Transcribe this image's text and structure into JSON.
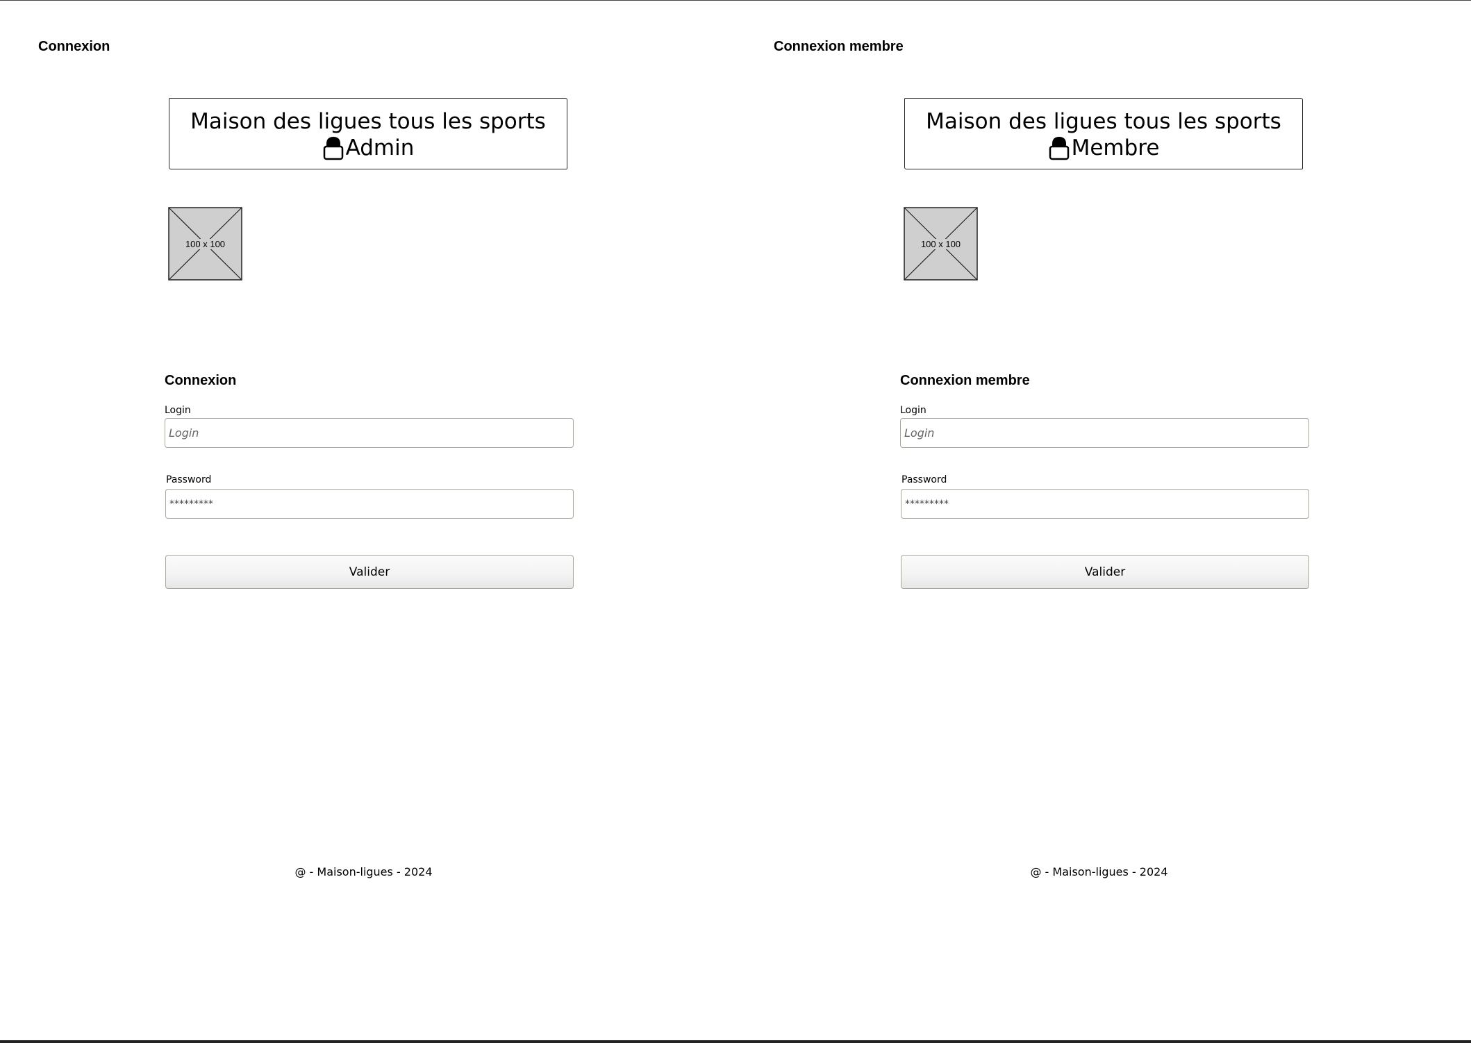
{
  "panels": [
    {
      "heading": "Connexion",
      "banner": {
        "title": "Maison des ligues tous les sports",
        "role": "Admin"
      },
      "image_placeholder": {
        "label": "100 x 100"
      },
      "form": {
        "title": "Connexion",
        "login_label": "Login",
        "login_placeholder": "Login",
        "password_label": "Password",
        "password_value": "*********",
        "submit_label": "Valider"
      },
      "footer": "@ - Maison-ligues - 2024"
    },
    {
      "heading": "Connexion membre",
      "banner": {
        "title": "Maison des ligues tous les sports",
        "role": "Membre"
      },
      "image_placeholder": {
        "label": "100 x 100"
      },
      "form": {
        "title": "Connexion membre",
        "login_label": "Login",
        "login_placeholder": "Login",
        "password_label": "Password",
        "password_value": "*********",
        "submit_label": "Valider"
      },
      "footer": "@ - Maison-ligues - 2024"
    }
  ],
  "icons": {
    "lock": "lock-icon",
    "image_placeholder": "image-placeholder-icon"
  },
  "colors": {
    "input_border": "#a7a79a",
    "placeholder_fill": "#cfcfcf",
    "text": "#000000"
  }
}
